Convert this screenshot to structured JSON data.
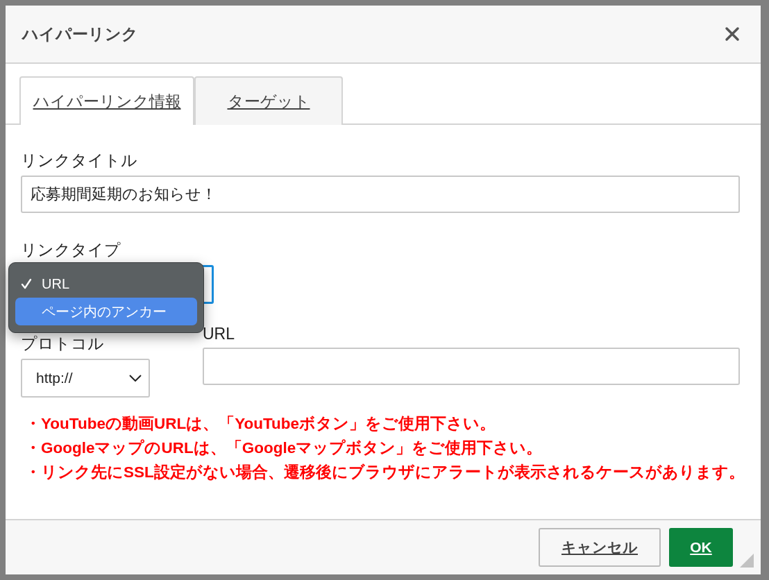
{
  "dialog": {
    "title": "ハイパーリンク"
  },
  "tabs": [
    {
      "label": "ハイパーリンク情報",
      "selected": true
    },
    {
      "label": "ターゲット",
      "selected": false
    }
  ],
  "link_title": {
    "label": "リンクタイトル",
    "value": "応募期間延期のお知らせ！"
  },
  "link_type": {
    "label": "リンクタイプ",
    "focused": true,
    "options": [
      {
        "label": "URL",
        "selected": true,
        "highlighted": false
      },
      {
        "label": "ページ内のアンカー",
        "selected": false,
        "highlighted": true
      }
    ]
  },
  "protocol": {
    "label": "プロトコル",
    "value": "http://"
  },
  "url": {
    "label": "URL"
  },
  "notes": [
    "・YouTubeの動画URLは、「YouTubeボタン」をご使用下さい。",
    "・GoogleマップのURLは、「Googleマップボタン」をご使用下さい。",
    "・リンク先にSSL設定がない場合、遷移後にブラウザにアラートが表示されるケースがあります。"
  ],
  "buttons": [
    {
      "label": "キャンセル",
      "kind": "secondary"
    },
    {
      "label": "OK",
      "kind": "primary"
    }
  ]
}
